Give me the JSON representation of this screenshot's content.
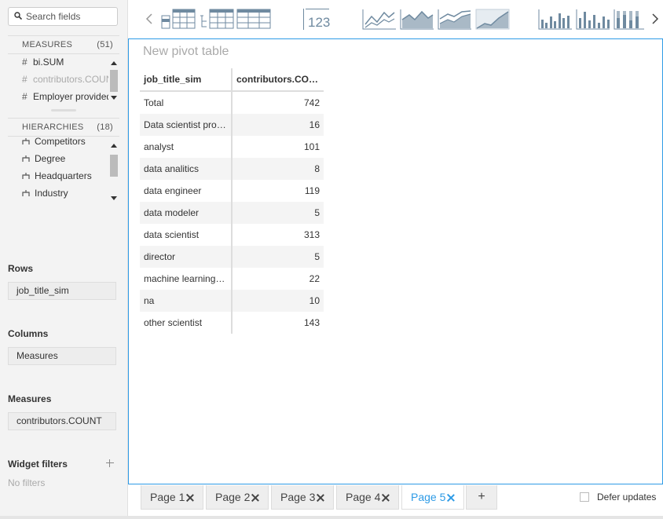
{
  "sidebar": {
    "search": {
      "placeholder": "Search fields"
    },
    "measures": {
      "label": "MEASURES",
      "count": "(51)",
      "items": [
        {
          "label": "bi.SUM",
          "dim": false
        },
        {
          "label": "contributors.COUNT",
          "dim": true
        },
        {
          "label": "Employer provided",
          "dim": false
        }
      ]
    },
    "hierarchies": {
      "label": "HIERARCHIES",
      "count": "(18)",
      "items": [
        "Competitors",
        "Degree",
        "Headquarters",
        "Industry"
      ]
    },
    "rows": {
      "label": "Rows",
      "value": "job_title_sim"
    },
    "columns": {
      "label": "Columns",
      "value": "Measures"
    },
    "measures_zone": {
      "label": "Measures",
      "value": "contributors.COUNT"
    },
    "widget_filters": {
      "label": "Widget filters",
      "empty": "No filters"
    }
  },
  "toolbar": {
    "kpi_label": "123",
    "icons": [
      "chevron-left-icon",
      "table-icon",
      "tree-table-icon",
      "pivot-table-icon",
      "kpi-icon",
      "line-chart-icon",
      "area-chart-icon",
      "stacked-area-chart-icon",
      "stacked-area-percent-icon",
      "clustered-column-icon",
      "column-chart-icon",
      "stacked-column-icon",
      "chevron-right-icon"
    ]
  },
  "widget": {
    "title": "New pivot table",
    "table": {
      "headers": [
        "job_title_sim",
        "contributors.COU…"
      ],
      "rows": [
        [
          "Total",
          "742"
        ],
        [
          "Data scientist proj…",
          "16"
        ],
        [
          "analyst",
          "101"
        ],
        [
          "data analitics",
          "8"
        ],
        [
          "data engineer",
          "119"
        ],
        [
          "data modeler",
          "5"
        ],
        [
          "data scientist",
          "313"
        ],
        [
          "director",
          "5"
        ],
        [
          "machine learning e…",
          "22"
        ],
        [
          "na",
          "10"
        ],
        [
          "other scientist",
          "143"
        ]
      ]
    }
  },
  "tabs": {
    "items": [
      "Page 1",
      "Page 2",
      "Page 3",
      "Page 4",
      "Page 5"
    ],
    "active_index": 4,
    "add_label": "+",
    "defer_label": "Defer updates"
  },
  "colors": {
    "accent": "#2e9be6",
    "icon": "#6f8aa0",
    "sidebar_bg": "#f3f3f3"
  }
}
